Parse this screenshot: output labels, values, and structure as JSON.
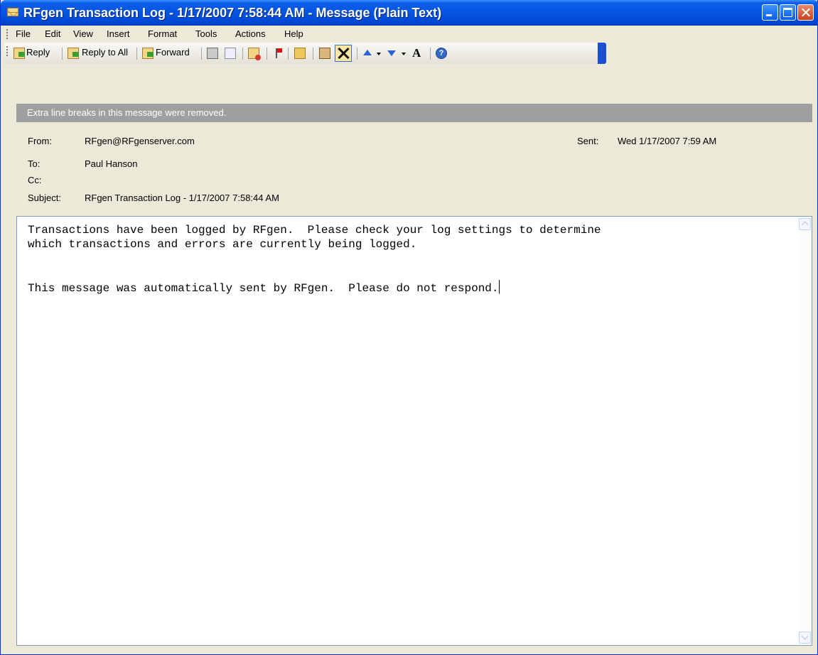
{
  "window": {
    "title": "RFgen Transaction Log - 1/17/2007 7:58:44 AM - Message (Plain Text)"
  },
  "menu": {
    "items": [
      {
        "name": "file",
        "label": "File"
      },
      {
        "name": "edit",
        "label": "Edit"
      },
      {
        "name": "view",
        "label": "View"
      },
      {
        "name": "insert",
        "label": "Insert"
      },
      {
        "name": "format",
        "label": "Format"
      },
      {
        "name": "tools",
        "label": "Tools"
      },
      {
        "name": "actions",
        "label": "Actions"
      },
      {
        "name": "help",
        "label": "Help"
      }
    ]
  },
  "toolbar": {
    "reply_label": "Reply",
    "reply_all_label": "Reply to All",
    "forward_label": "Forward",
    "font_size_glyph": "A",
    "icons": [
      "reply-icon",
      "reply-all-icon",
      "forward-icon",
      "printer-icon",
      "copy-icon",
      "mark-unread-icon",
      "flag-icon",
      "move-to-folder-icon",
      "paste-icon",
      "delete-icon",
      "previous-item-icon",
      "next-item-icon",
      "font-size-icon",
      "help-icon"
    ]
  },
  "infobar": {
    "text": "Extra line breaks in this message were removed."
  },
  "header": {
    "from_label": "From:",
    "from_value": "RFgen@RFgenserver.com",
    "sent_label": "Sent:",
    "sent_value": "Wed 1/17/2007 7:59 AM",
    "to_label": "To:",
    "to_value": "Paul Hanson",
    "cc_label": "Cc:",
    "cc_value": "",
    "subject_label": "Subject:",
    "subject_value": "RFgen Transaction Log - 1/17/2007 7:58:44 AM"
  },
  "body": {
    "line1": "Transactions have been logged by RFgen.  Please check your log settings to determine",
    "line2": "which transactions and errors are currently being logged.",
    "line3": "This message was automatically sent by RFgen.  Please do not respond."
  },
  "colors": {
    "title_bar": "#0454e1",
    "chrome": "#ece9d8",
    "infobar": "#9e9fa1"
  }
}
